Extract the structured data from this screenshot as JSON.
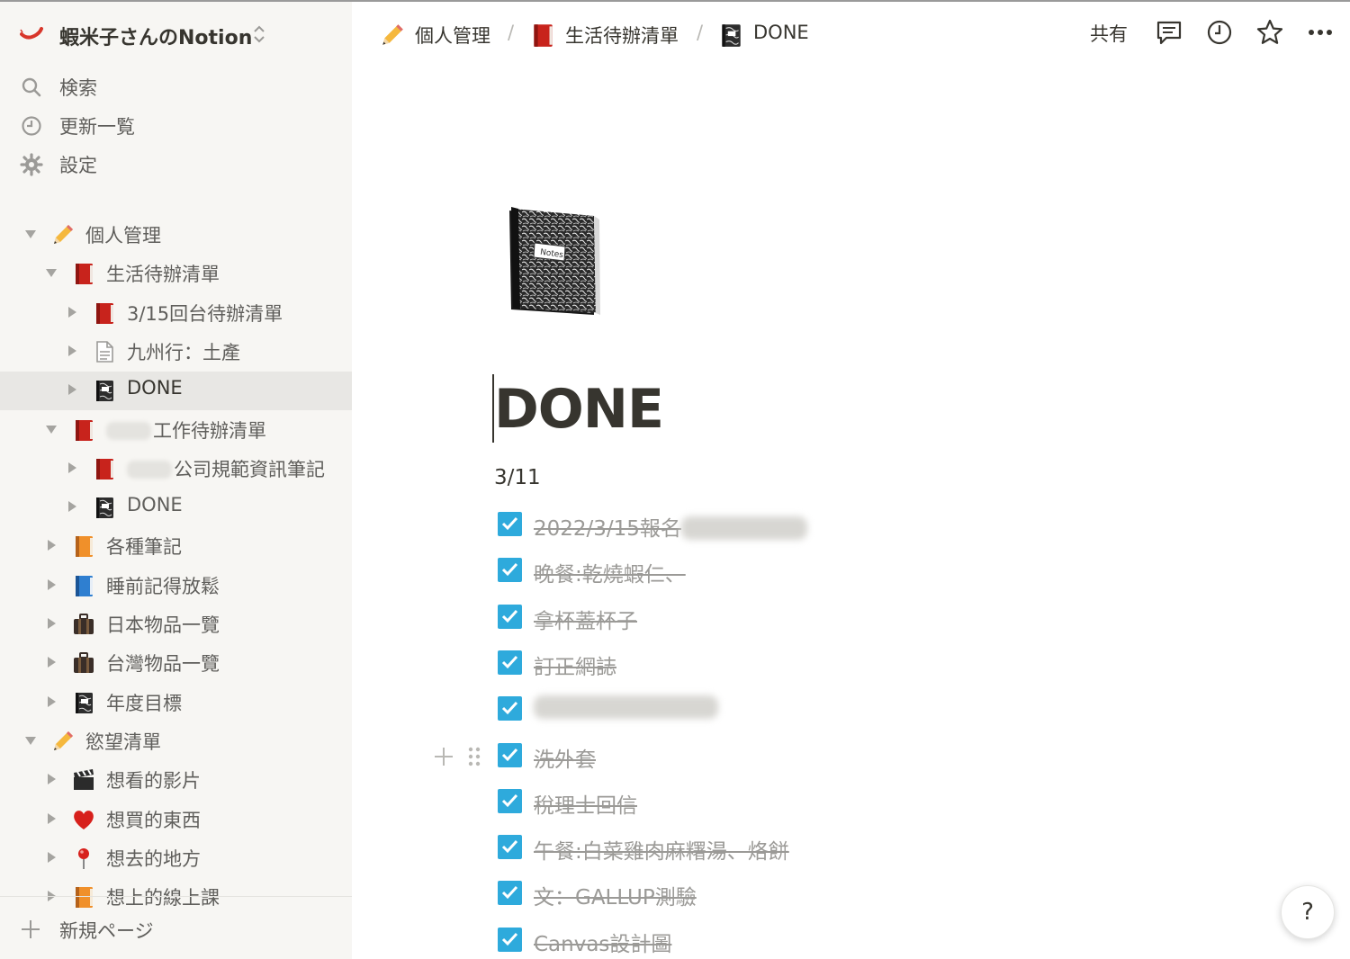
{
  "workspace": {
    "name": "蝦米子さんのNotion"
  },
  "nav": [
    {
      "label": "検索",
      "icon": "search-icon"
    },
    {
      "label": "更新一覧",
      "icon": "clock-icon"
    },
    {
      "label": "設定",
      "icon": "gear-icon"
    }
  ],
  "tree": [
    {
      "label": "個人管理",
      "emoji": "pencil",
      "expanded": true,
      "depth": 0
    },
    {
      "label": "生活待辦清單",
      "emoji": "red-book",
      "expanded": true,
      "depth": 1
    },
    {
      "label": "3/15回台待辦清單",
      "emoji": "red-book",
      "expanded": false,
      "depth": 2
    },
    {
      "label": "九州行：土產",
      "emoji": "page",
      "expanded": false,
      "depth": 2
    },
    {
      "label": "DONE",
      "emoji": "notebook",
      "expanded": false,
      "depth": 2,
      "active": true
    },
    {
      "label": "工作待辦清單",
      "emoji": "red-book",
      "expanded": true,
      "depth": 1,
      "blurred_prefix": true
    },
    {
      "label": "公司規範資訊筆記",
      "emoji": "red-book",
      "expanded": false,
      "depth": 2,
      "blurred_prefix": true
    },
    {
      "label": "DONE",
      "emoji": "notebook",
      "expanded": false,
      "depth": 2
    },
    {
      "label": "各種筆記",
      "emoji": "orange-book",
      "expanded": false,
      "depth": 1
    },
    {
      "label": "睡前記得放鬆",
      "emoji": "blue-book",
      "expanded": false,
      "depth": 1
    },
    {
      "label": "日本物品一覽",
      "emoji": "luggage",
      "expanded": false,
      "depth": 1
    },
    {
      "label": "台灣物品一覽",
      "emoji": "luggage",
      "expanded": false,
      "depth": 1
    },
    {
      "label": "年度目標",
      "emoji": "notebook",
      "expanded": false,
      "depth": 1
    },
    {
      "label": "慾望清單",
      "emoji": "pencil",
      "expanded": true,
      "depth": 0
    },
    {
      "label": "想看的影片",
      "emoji": "clapper",
      "expanded": false,
      "depth": 1
    },
    {
      "label": "想買的東西",
      "emoji": "heart",
      "expanded": false,
      "depth": 1
    },
    {
      "label": "想去的地方",
      "emoji": "pin",
      "expanded": false,
      "depth": 1
    },
    {
      "label": "想上的線上課",
      "emoji": "orange-book",
      "expanded": false,
      "depth": 1
    }
  ],
  "new_page_label": "新規ページ",
  "breadcrumb": [
    {
      "label": "個人管理",
      "emoji": "pencil"
    },
    {
      "label": "生活待辦清單",
      "emoji": "red-book"
    },
    {
      "label": "DONE",
      "emoji": "notebook"
    }
  ],
  "breadcrumb_separator": "/",
  "topbar": {
    "share_label": "共有"
  },
  "page": {
    "title": "DONE",
    "date_heading": "3/11",
    "todos": [
      {
        "text": "2022/3/15報名",
        "checked": true,
        "blurred_suffix": true
      },
      {
        "text": "晚餐:乾燒蝦仁、",
        "checked": true
      },
      {
        "text": "拿杯蓋杯子",
        "checked": true
      },
      {
        "text": "訂正網誌",
        "checked": true
      },
      {
        "text": "",
        "checked": true,
        "blurred_only": true
      },
      {
        "text": "洗外套",
        "checked": true
      },
      {
        "text": "稅理士回信",
        "checked": true
      },
      {
        "text": "午餐:白菜雞肉麻糬湯、烙餅",
        "checked": true
      },
      {
        "text": "文：GALLUP測驗",
        "checked": true
      },
      {
        "text": "Canvas設計圖",
        "checked": true
      }
    ]
  },
  "help_label": "?",
  "colors": {
    "sidebar_bg": "#f7f6f3",
    "checkbox": "#2eaadc",
    "text": "#37352f",
    "muted": "#9b9a97"
  }
}
